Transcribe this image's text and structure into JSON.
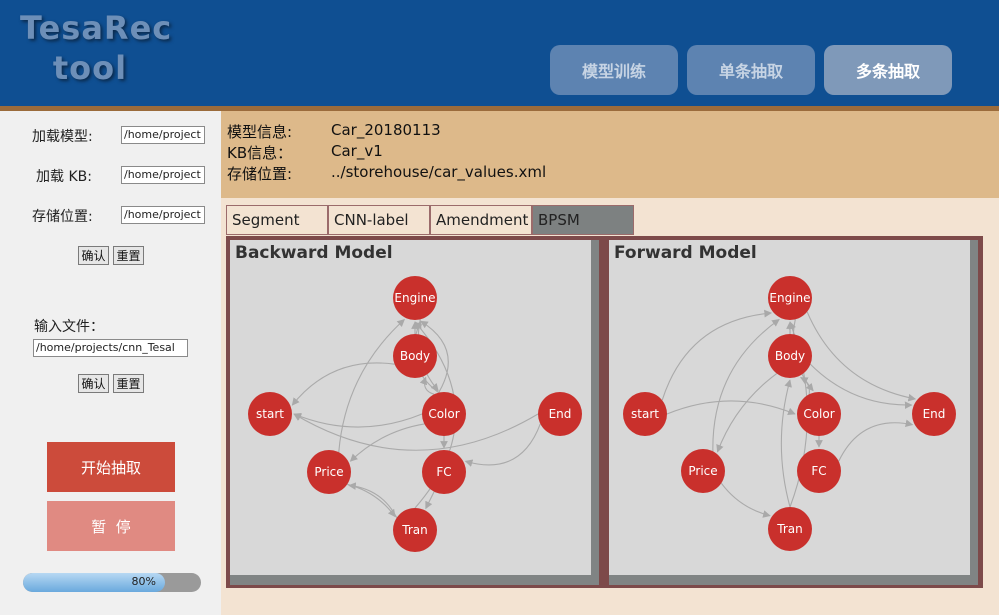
{
  "header": {
    "logo_line1": "TesaRec",
    "logo_line2": "tool",
    "tabs": [
      {
        "label": "模型训练"
      },
      {
        "label": "单条抽取"
      },
      {
        "label": "多条抽取"
      }
    ],
    "colors": {
      "bar": "#0f4f92",
      "active_tab": "#7f99b9",
      "inactive_tab": "#5d83b1"
    }
  },
  "left": {
    "load_model_label": "加载模型:",
    "load_model_value": "/home/project",
    "load_kb_label": "加载 KB:",
    "load_kb_value": "/home/project",
    "save_path_label": "存储位置:",
    "save_path_value": "/home/project",
    "confirm_label": "确认",
    "reset_label": "重置",
    "input_file_label": "输入文件：",
    "input_file_value": "/home/projects/cnn_Tesal",
    "start_label": "开始抽取",
    "pause_label": "暂  停",
    "progress": 80,
    "progress_text": "80%"
  },
  "info": {
    "model_label": "模型信息:",
    "model_value": "Car_20180113",
    "kb_label": "KB信息：",
    "kb_value": "Car_v1",
    "path_label": "存储位置:",
    "path_value": "../storehouse/car_values.xml"
  },
  "work": {
    "tabs": [
      {
        "label": "Segment"
      },
      {
        "label": "CNN-label"
      },
      {
        "label": "Amendment"
      },
      {
        "label": "BPSM"
      }
    ],
    "active_tab": "BPSM",
    "backward": {
      "title": "Backward Model",
      "nodes": [
        {
          "id": "engine",
          "label": "Engine"
        },
        {
          "id": "body",
          "label": "Body"
        },
        {
          "id": "start",
          "label": "start"
        },
        {
          "id": "color",
          "label": "Color"
        },
        {
          "id": "end",
          "label": "End"
        },
        {
          "id": "price",
          "label": "Price"
        },
        {
          "id": "fc",
          "label": "FC"
        },
        {
          "id": "tran",
          "label": "Tran"
        }
      ]
    },
    "forward": {
      "title": "Forward Model",
      "nodes": [
        {
          "id": "engine",
          "label": "Engine"
        },
        {
          "id": "body",
          "label": "Body"
        },
        {
          "id": "start",
          "label": "start"
        },
        {
          "id": "color",
          "label": "Color"
        },
        {
          "id": "end",
          "label": "End"
        },
        {
          "id": "price",
          "label": "Price"
        },
        {
          "id": "fc",
          "label": "FC"
        },
        {
          "id": "tran",
          "label": "Tran"
        }
      ]
    },
    "node_color": "#c9302c"
  }
}
